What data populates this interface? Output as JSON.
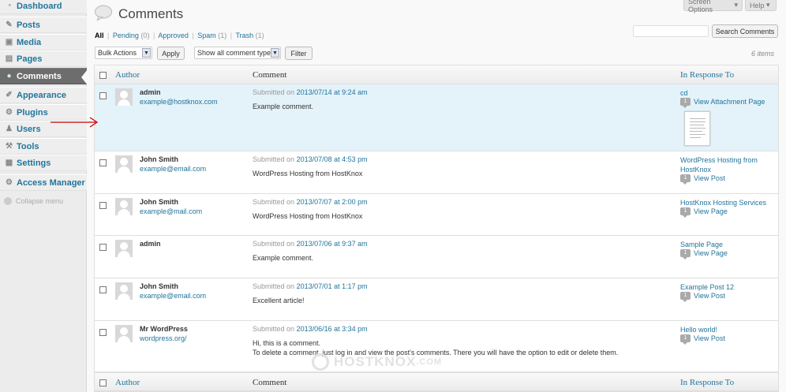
{
  "sidebar": {
    "items": [
      {
        "label": "Dashboard",
        "icon": "dashboard-icon"
      },
      {
        "label": "Posts",
        "icon": "posts-pin-icon"
      },
      {
        "label": "Media",
        "icon": "media-icon"
      },
      {
        "label": "Pages",
        "icon": "pages-icon"
      },
      {
        "label": "Comments",
        "icon": "comments-bubble-icon",
        "current": true
      },
      {
        "label": "Appearance",
        "icon": "appearance-icon"
      },
      {
        "label": "Plugins",
        "icon": "plugins-icon"
      },
      {
        "label": "Users",
        "icon": "users-icon"
      },
      {
        "label": "Tools",
        "icon": "tools-icon"
      },
      {
        "label": "Settings",
        "icon": "settings-icon"
      },
      {
        "label": "Access Manager",
        "icon": "access-manager-icon"
      }
    ],
    "collapse_label": "Collapse menu"
  },
  "header": {
    "screen_options": "Screen Options",
    "help": "Help",
    "title": "Comments"
  },
  "filters": {
    "all": "All",
    "pending": "Pending",
    "pending_count": "(0)",
    "approved": "Approved",
    "spam": "Spam",
    "spam_count": "(1)",
    "trash": "Trash",
    "trash_count": "(1)",
    "separator": "|"
  },
  "search": {
    "placeholder": "",
    "button": "Search Comments"
  },
  "toolbar": {
    "bulk_actions": "Bulk Actions",
    "apply": "Apply",
    "comment_types": "Show all comment types",
    "filter": "Filter",
    "items_count": "6 items"
  },
  "table": {
    "columns": {
      "author": "Author",
      "comment": "Comment",
      "response": "In Response To"
    },
    "submitted_prefix": "Submitted on",
    "rows": [
      {
        "author": "admin",
        "email": "example@hostknox.com",
        "date": "2013/07/14 at 9:24 am",
        "text": "Example comment.",
        "response_title": "cd",
        "count": "1",
        "view": "View Attachment Page"
      },
      {
        "author": "John Smith",
        "email": "example@email.com",
        "date": "2013/07/08 at 4:53 pm",
        "text": "WordPress Hosting from HostKnox",
        "response_title": "WordPress Hosting from HostKnox",
        "count": "1",
        "view": "View Post"
      },
      {
        "author": "John Smith",
        "email": "example@mail.com",
        "date": "2013/07/07 at 2:00 pm",
        "text": "WordPress Hosting from HostKnox",
        "response_title": "HostKnox Hosting Services",
        "count": "1",
        "view": "View Page"
      },
      {
        "author": "admin",
        "email": "",
        "date": "2013/07/06 at 9:37 am",
        "text": "Example comment.",
        "response_title": "Sample Page",
        "count": "1",
        "view": "View Page"
      },
      {
        "author": "John Smith",
        "email": "example@email.com",
        "date": "2013/07/01 at 1:17 pm",
        "text": "Excellent article!",
        "response_title": "Example Post 12",
        "count": "1",
        "view": "View Post"
      },
      {
        "author": "Mr WordPress",
        "email": "wordpress.org/",
        "date": "2013/06/16 at 3:34 pm",
        "text": "Hi, this is a comment.",
        "text2": "To delete a comment, just log in and view the post's comments. There you will have the option to edit or delete them.",
        "response_title": "Hello world!",
        "count": "1",
        "view": "View Post"
      }
    ]
  },
  "watermark": {
    "text": "HOSTKNOX",
    "suffix": ".COM"
  },
  "colors": {
    "link": "#21759b",
    "current_menu": "#6d6d6d",
    "highlight_row": "#e4f2fa",
    "arrow": "#cc0000"
  }
}
